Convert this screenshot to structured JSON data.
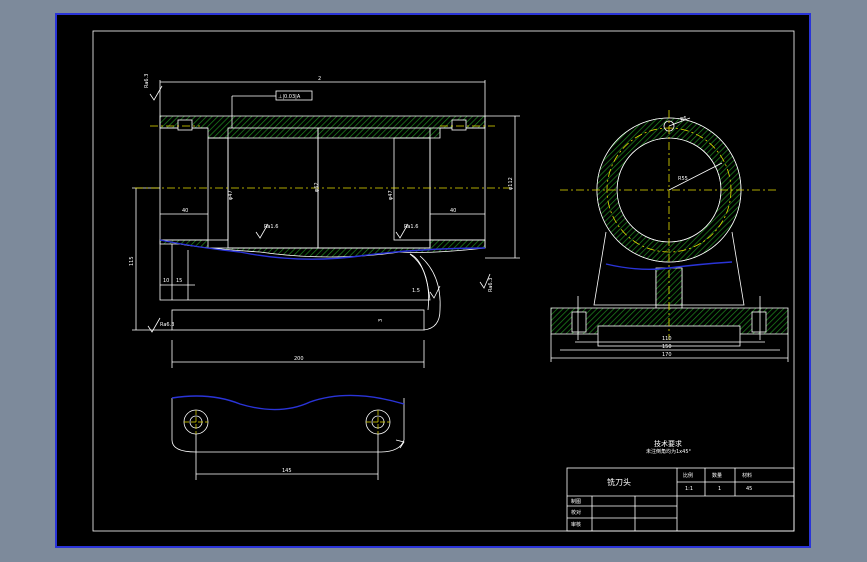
{
  "drawing": {
    "colors": {
      "background": "#7d8a9b",
      "sheet": "#000000",
      "sheet_border": "#2a34d8",
      "line": "#ffffff",
      "hatch": "#1f8a1f",
      "centerline": "#e8e000",
      "contour_blue": "#2a34d8"
    },
    "front_view": {
      "overall_width": "2",
      "tolerance_frame": "⊥|0.03|A",
      "roughness_top": "Ra6.3",
      "roughness_bore_left": "Ra1.6",
      "roughness_bore_right": "Ra1.6",
      "roughness_left_face": "Ra6.3",
      "roughness_foot": "Ra6.3",
      "bore_left": "φ47",
      "bore_mid": "φ62",
      "bore_right": "φ47",
      "dim_left_40": "40",
      "dim_right_40": "40",
      "height_right": "φ112",
      "height_left": "115",
      "foot_10": "10",
      "foot_15": "15",
      "slot_dim": "3",
      "base_length": "200",
      "small_note": "1.5"
    },
    "side_view": {
      "radius_label": "R55",
      "hole_label": "φ6",
      "dim_110": "110",
      "dim_150": "150",
      "dim_170": "170"
    },
    "bottom_view": {
      "hole_spacing": "145"
    },
    "notes": {
      "title": "技术要求",
      "line1": "未注倒角均为1x45°"
    },
    "title_block": {
      "part_name": "铣刀头",
      "col_scale": "比例",
      "col_qty": "数量",
      "col_material": "材料",
      "scale_value": "1:1",
      "qty_value": "1",
      "material_value": "45",
      "row_draw": "制图",
      "row_check": "校对",
      "row_review": "审核"
    }
  }
}
